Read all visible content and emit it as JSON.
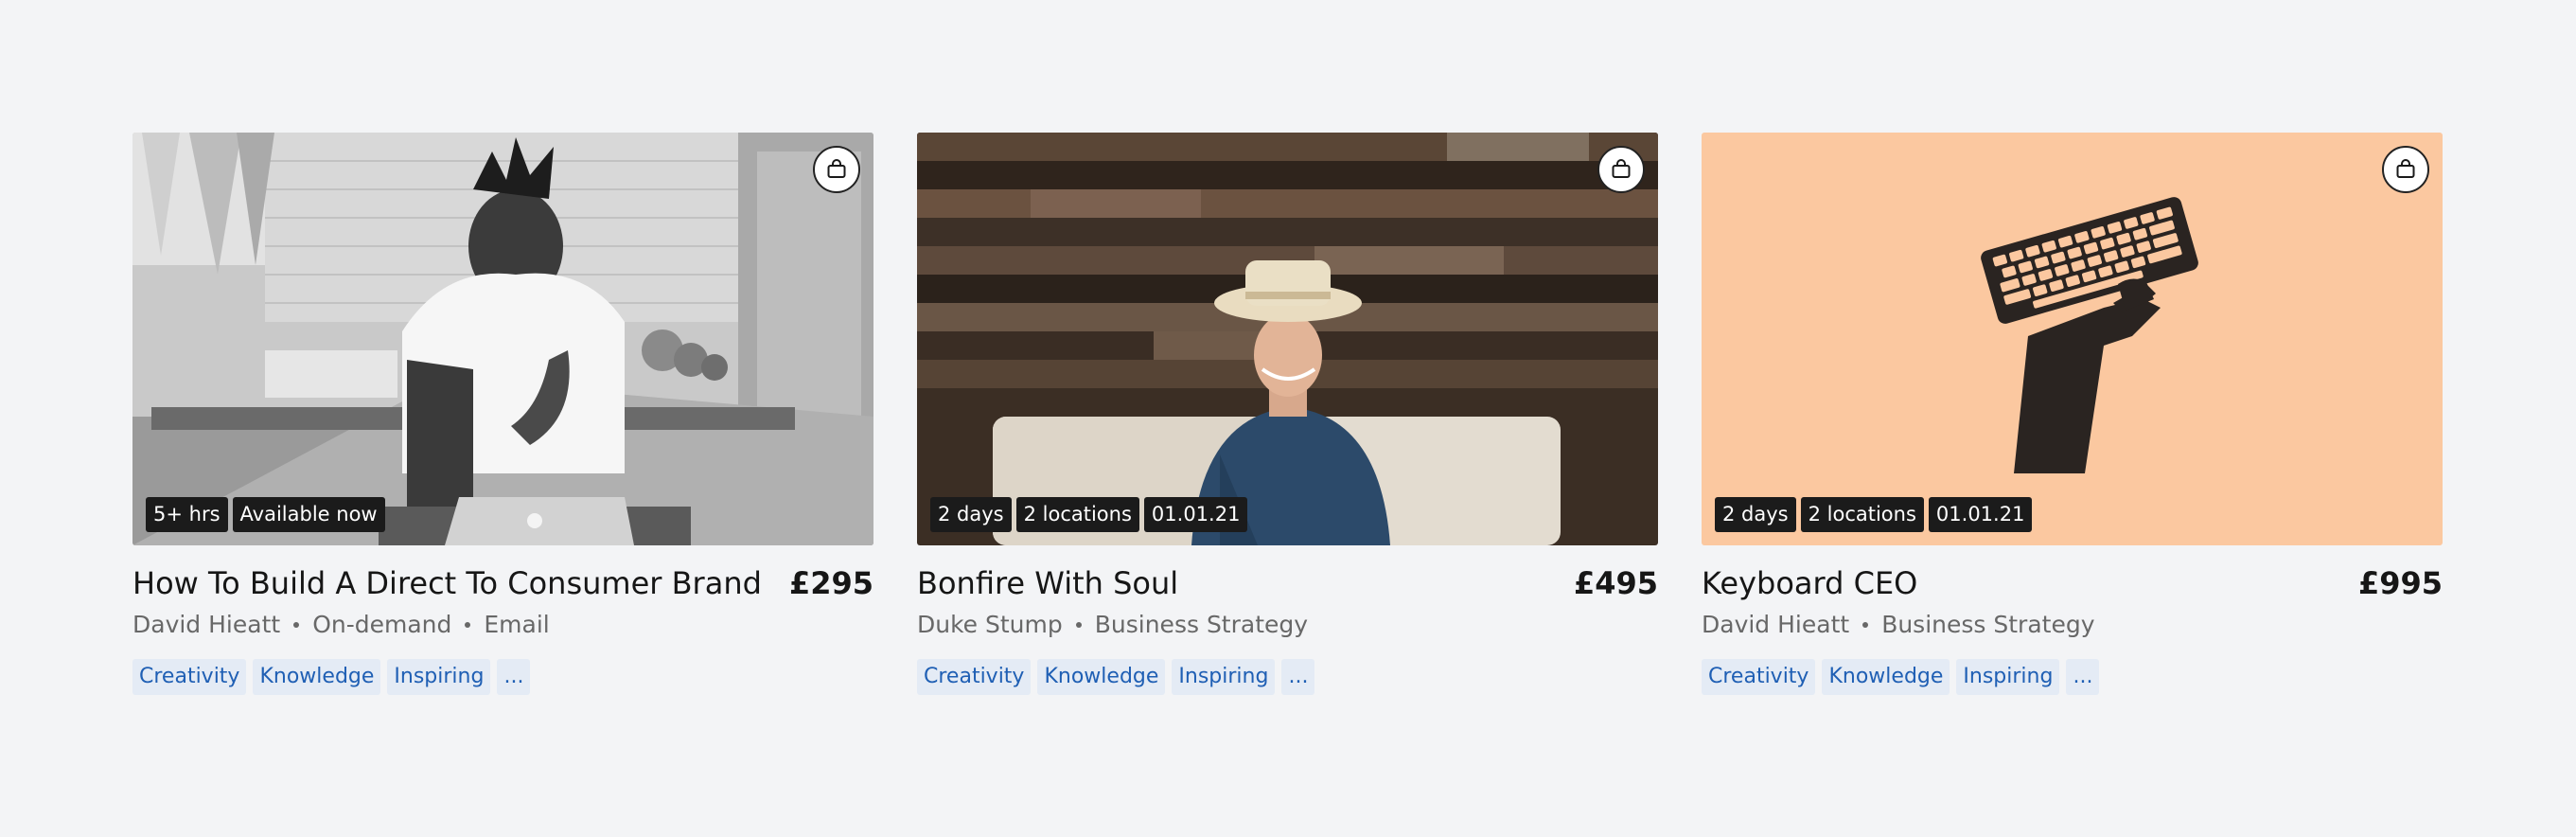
{
  "cards": [
    {
      "title": "How To Build A Direct To Consumer Brand",
      "price": "£295",
      "author": "David Hieatt",
      "meta": [
        "On-demand",
        "Email"
      ],
      "badges": [
        "5+ hrs",
        "Available now"
      ],
      "tags": [
        "Creativity",
        "Knowledge",
        "Inspiring",
        "..."
      ],
      "image_icon": "photo-man-laptop-icon",
      "background": "#bdbdbd"
    },
    {
      "title": "Bonfire With Soul",
      "price": "£495",
      "author": "Duke Stump",
      "meta": [
        "Business Strategy"
      ],
      "badges": [
        "2 days",
        "2 locations",
        "01.01.21"
      ],
      "tags": [
        "Creativity",
        "Knowledge",
        "Inspiring",
        "..."
      ],
      "image_icon": "photo-man-hat-icon",
      "background": "#4a3a2c"
    },
    {
      "title": "Keyboard CEO",
      "price": "£995",
      "author": "David Hieatt",
      "meta": [
        "Business Strategy"
      ],
      "badges": [
        "2 days",
        "2 locations",
        "01.01.21"
      ],
      "tags": [
        "Creativity",
        "Knowledge",
        "Inspiring",
        "..."
      ],
      "image_icon": "hand-keyboard-illustration-icon",
      "background": "#fbc8a0"
    }
  ],
  "colors": {
    "page_background": "#f3f4f6",
    "tag_background": "#e4ebf5",
    "tag_text": "#1f5fb4",
    "badge_background": "#1b1b1b"
  }
}
